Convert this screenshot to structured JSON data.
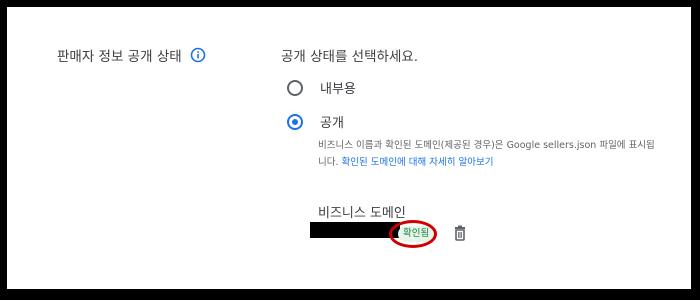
{
  "left": {
    "label": "판매자 정보 공개 상태"
  },
  "section": {
    "title": "공개 상태를 선택하세요."
  },
  "options": [
    {
      "label": "내부용",
      "selected": false
    },
    {
      "label": "공개",
      "selected": true
    }
  ],
  "public_description": {
    "text": "비즈니스 이름과 확인된 도메인(제공된 경우)은 Google sellers.json 파일에 표시됩니다.",
    "link": "확인된 도메인에 대해 자세히 알아보기"
  },
  "domain": {
    "title": "비즈니스 도메인",
    "badge": "확인됨"
  },
  "colors": {
    "accent": "#1a73e8",
    "verified_text": "#188038",
    "verified_bg": "#e6f4ea",
    "highlight": "#d00000"
  },
  "icons": {
    "info": "info-icon",
    "delete": "trash-icon"
  }
}
